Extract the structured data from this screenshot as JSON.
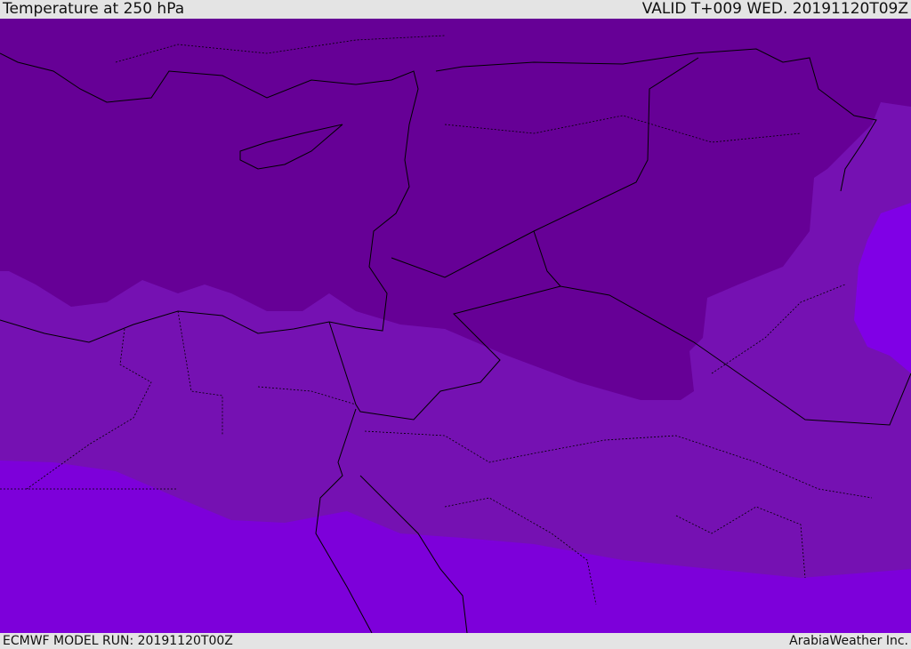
{
  "header": {
    "title": "Temperature at 250 hPa",
    "valid": "VALID T+009 WED. 20191120T09Z"
  },
  "footer": {
    "model_run": "ECMWF MODEL RUN: 20191120T00Z",
    "credit": "ArabiaWeather Inc."
  },
  "colors": {
    "cold": "#660096",
    "mid": "#7511b2",
    "warm": "#7d00da",
    "warmest": "#8000e6",
    "bar": "#e4e4e4"
  }
}
